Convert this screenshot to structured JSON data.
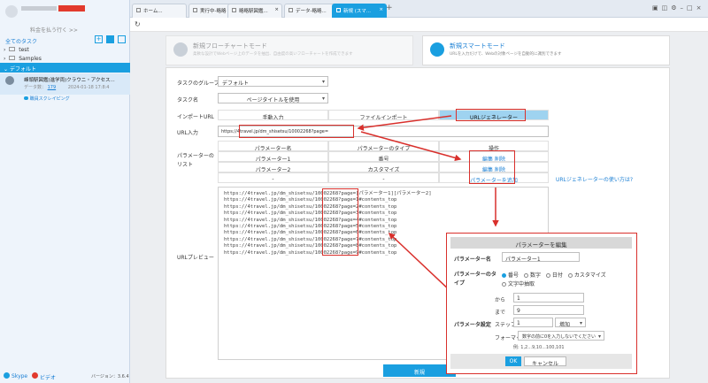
{
  "sidebar": {
    "user_subtitle": "料金を払う行く >>",
    "all_tasks": "全てのタスク",
    "folders": [
      "test",
      "Samples"
    ],
    "group_title": "デフォルト",
    "task": {
      "title": "峰頭駅図鑑(進学両)クラウニ・アクセス...",
      "data_label": "データ数：",
      "data_count": "179",
      "date": "2024-01-18 17:8:4",
      "sub": "職員スクレイピング"
    },
    "footer": {
      "skype": "Skype",
      "video": "ビデオ",
      "version": "バージョン：3.6.4"
    }
  },
  "tabs": [
    "ホーム...",
    "実行中-略略",
    "略略駅図鑑...",
    "データ-略略...",
    "新規 (スマ..."
  ],
  "modes": {
    "flowchart": {
      "title": "新規フローチャートモード",
      "desc": "柔軟な設計でWebページ上のデータを抽出、自由度の高いフローチャートを作成できます"
    },
    "smart": {
      "title": "新規スマートモード",
      "desc": "URLを入力だけで、Webの対象ページを自動的に識別できます"
    }
  },
  "form": {
    "group_label": "タスクのグループ",
    "group_value": "デフォルト",
    "name_label": "タスク名",
    "name_value": "ページタイトルを使用",
    "import_label": "インポートURL",
    "import_tabs": [
      "手動入力",
      "ファイルインポート",
      "URLジェネレーター"
    ],
    "url_label": "URL入力",
    "url_value": "https://4travel.jp/dm_shisetsu/10002268?page=",
    "param_label": "パラメーターのリスト",
    "param_headers": [
      "パラメーター名",
      "パラメーターのタイプ",
      "操作"
    ],
    "params": [
      {
        "name": "パラメーター1",
        "type": "番号",
        "edit": "編集",
        "del": "削除"
      },
      {
        "name": "パラメーター2",
        "type": "カスタマイズ",
        "edit": "編集",
        "del": "削除"
      },
      {
        "name": "-",
        "type": "-",
        "add": "パラメーターを追加"
      }
    ],
    "gen_help": "URLジェネレーターの使い方は?",
    "preview_label": "URLプレビュー",
    "preview_lines": [
      "https://4travel.jp/dm_shisetsu/10002268?page=[パラメーター1][パラメーター2]",
      "https://4travel.jp/dm_shisetsu/10002268?page=1#contents_top",
      "https://4travel.jp/dm_shisetsu/10002268?page=2#contents_top",
      "https://4travel.jp/dm_shisetsu/10002268?page=3#contents_top",
      "https://4travel.jp/dm_shisetsu/10002268?page=4#contents_top",
      "https://4travel.jp/dm_shisetsu/10002268?page=5#contents_top",
      "https://4travel.jp/dm_shisetsu/10002268?page=6#contents_top",
      "https://4travel.jp/dm_shisetsu/10002268?page=7#contents_top",
      "https://4travel.jp/dm_shisetsu/10002268?page=8#contents_top",
      "https://4travel.jp/dm_shisetsu/10002268?page=9#contents_top"
    ],
    "submit": "新規"
  },
  "dialog": {
    "title": "パラメーターを編集",
    "name_label": "パラメーター名",
    "name_value": "パラメーター1",
    "type_label": "パラメーターのタイプ",
    "types": [
      "番号",
      "数字",
      "日付",
      "カスタマイズ",
      "文字中抽取"
    ],
    "from_label": "から",
    "from_value": "1",
    "to_label": "まで",
    "to_value": "9",
    "setting_label": "パラメータ設定",
    "step_label": "ステップ",
    "step_value": "1",
    "step_mode": "増加",
    "format_label": "フォーマット",
    "format_value": "数字の前に0を入力しないでください",
    "example": "例: 1,2...9,10...100,101",
    "ok": "OK",
    "cancel": "キャンセル"
  },
  "colors": {
    "accent": "#1a9fe0",
    "highlight": "#d9302c"
  }
}
